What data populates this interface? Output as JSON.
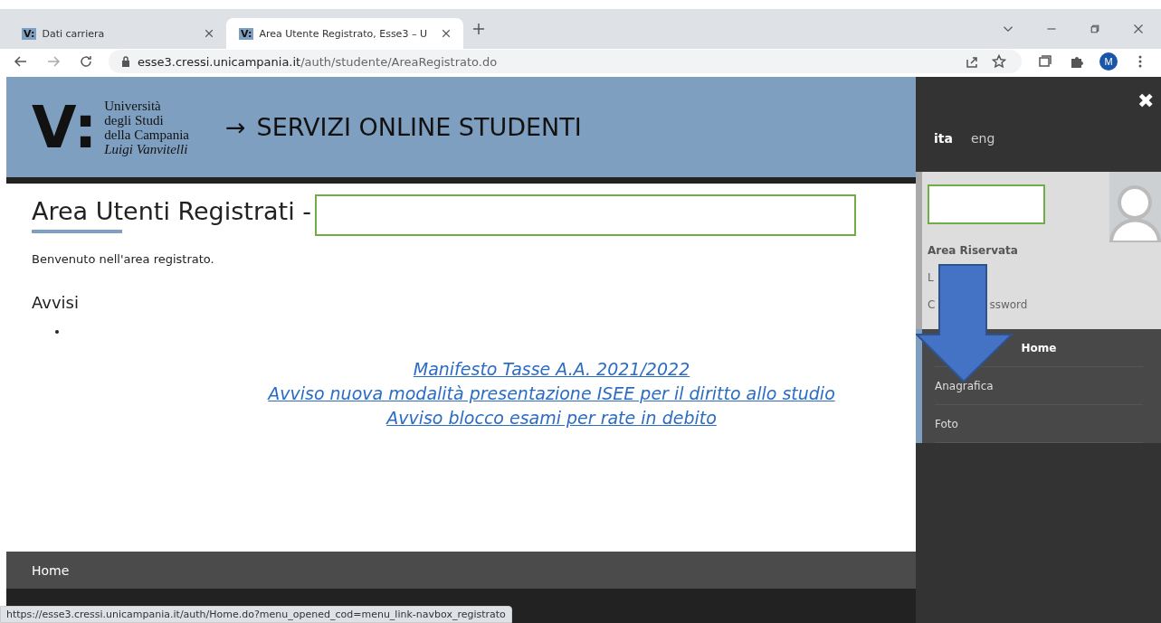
{
  "browser": {
    "tabs": [
      {
        "favicon": "V:",
        "title": "Dati carriera",
        "selected": false
      },
      {
        "favicon": "V:",
        "title": "Area Utente Registrato, Esse3 – U",
        "selected": true
      }
    ],
    "url_host": "esse3.cressi.unicampania.it",
    "url_path": "/auth/studente/AreaRegistrato.do",
    "profile": "M"
  },
  "header": {
    "logo_mark": "V:",
    "logo_lines": [
      "Università",
      "degli Studi",
      "della Campania"
    ],
    "logo_italic": "Luigi Vanvitelli",
    "arrow": "→",
    "title": "SERVIZI ONLINE STUDENTI"
  },
  "page": {
    "title": "Area Utenti Registrati -",
    "welcome": "Benvenuto nell'area registrato.",
    "notices_title": "Avvisi",
    "links": [
      "Manifesto Tasse A.A. 2021/2022",
      "Avviso nuova modalità presentazione ISEE per il diritto allo studio",
      "Avviso blocco esami per rate in debito"
    ]
  },
  "footer": {
    "link": "Home"
  },
  "status_url": "https://esse3.cressi.unicampania.it/auth/Home.do?menu_opened_cod=menu_link-navbox_registrato",
  "panel": {
    "close": "✖",
    "languages": [
      {
        "label": "ita",
        "selected": true
      },
      {
        "label": "eng",
        "selected": false
      }
    ],
    "section_title": "Area Riservata",
    "section_items": [
      [
        "L"
      ],
      [
        "C",
        "ssword"
      ]
    ],
    "menu": [
      {
        "label": "Home",
        "selected": true
      },
      {
        "label": "Anagrafica",
        "selected": false
      },
      {
        "label": "Foto",
        "selected": false
      }
    ]
  }
}
